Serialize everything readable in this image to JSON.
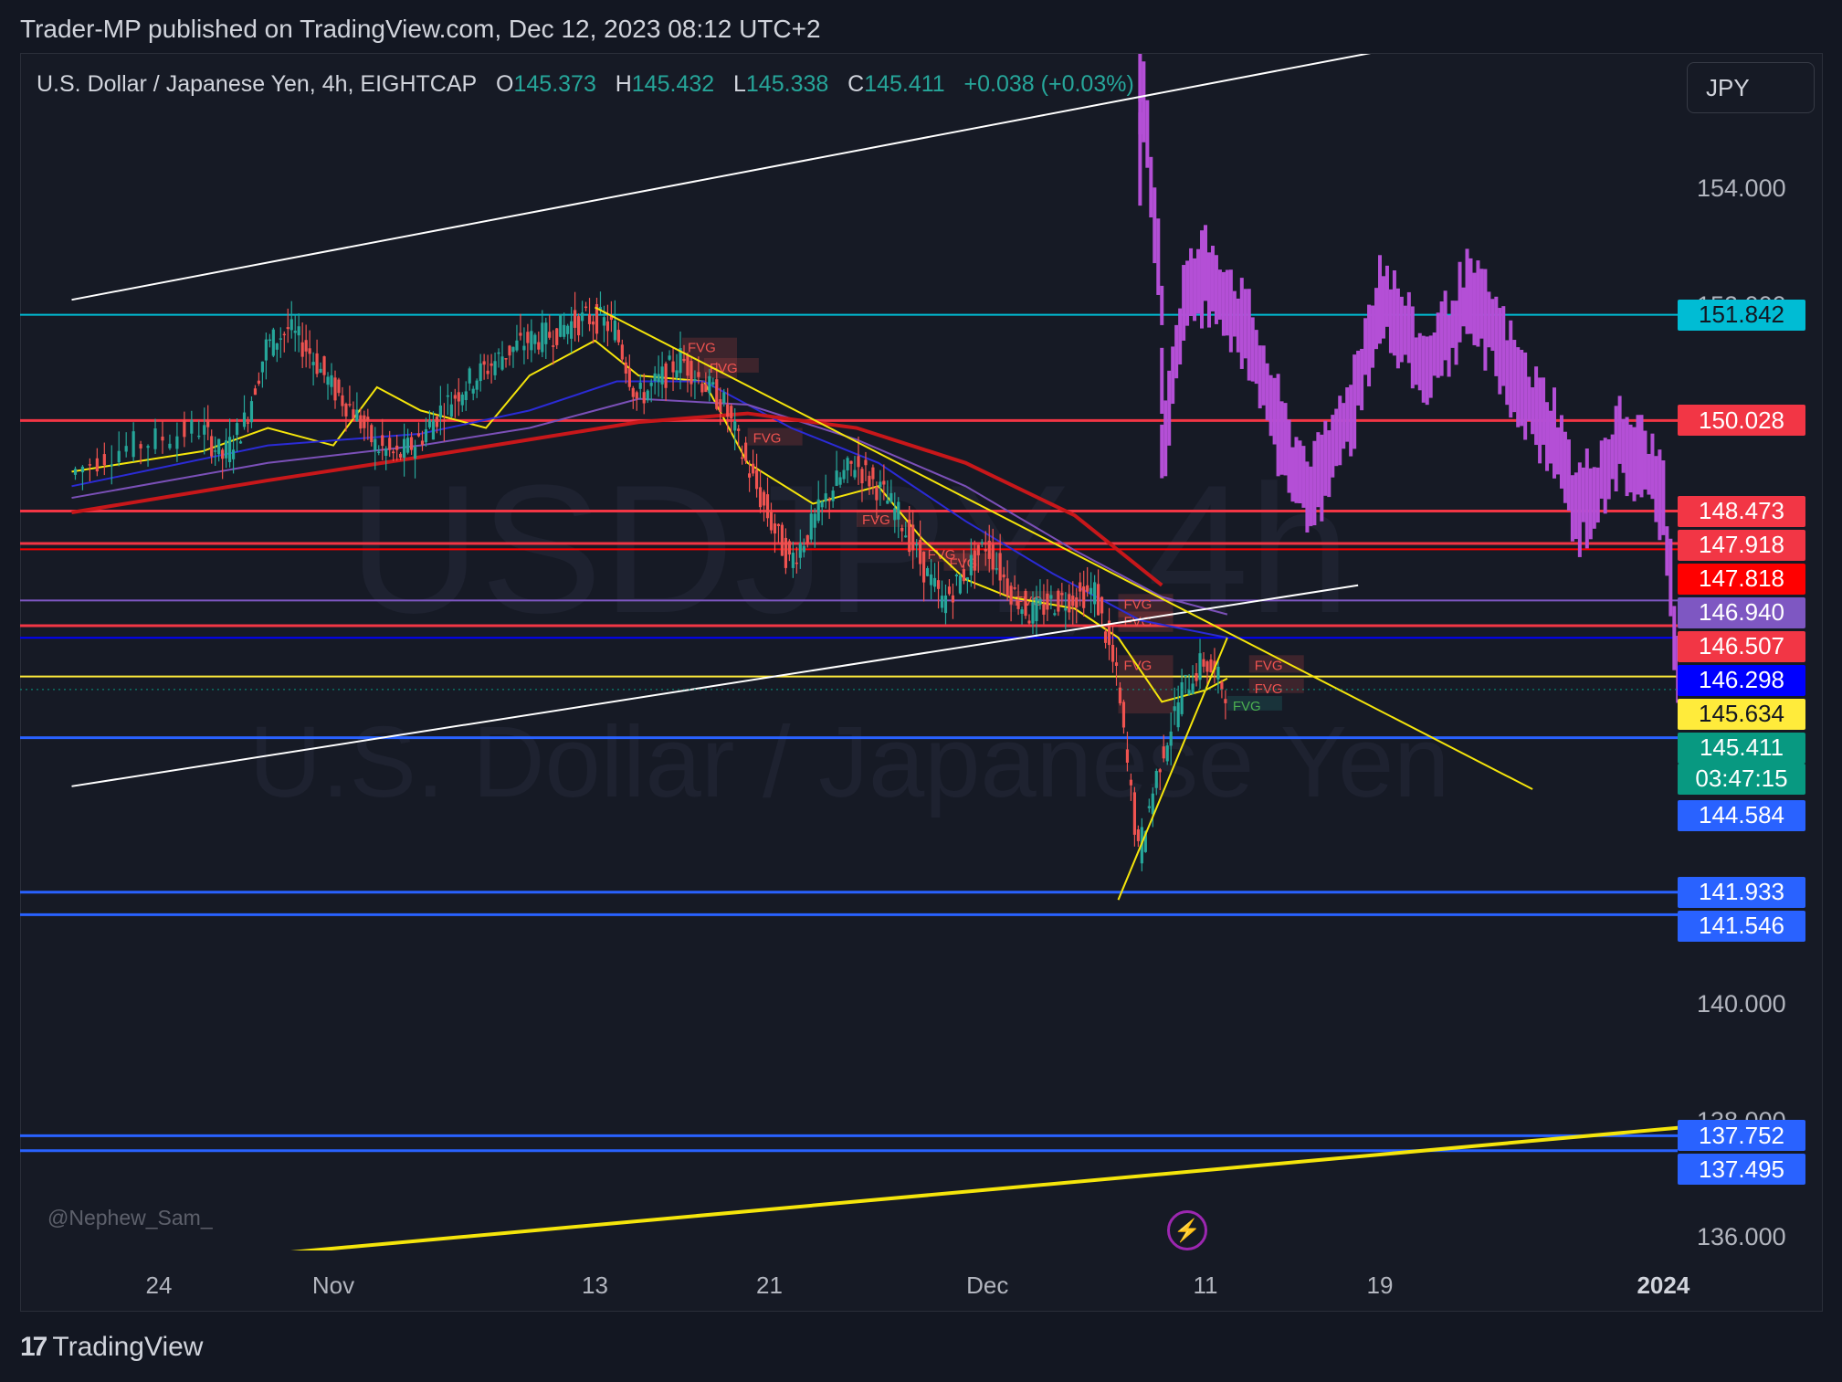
{
  "caption": "Trader-MP published on TradingView.com, Dec 12, 2023 08:12 UTC+2",
  "footer_brand": "TradingView",
  "footer_mark": "17",
  "currency_button": "JPY",
  "user_watermark": "@Nephew_Sam_",
  "bolt_icon": "lightning-bolt-icon",
  "watermark": {
    "symbol": "USDJPY, 4h",
    "name": "U.S. Dollar / Japanese Yen"
  },
  "legend": {
    "symbol": "U.S. Dollar / Japanese Yen, 4h, EIGHTCAP",
    "o_label": "O",
    "o": "145.373",
    "h_label": "H",
    "h": "145.432",
    "l_label": "L",
    "l": "145.338",
    "c_label": "C",
    "c": "145.411",
    "change": "+0.038 (+0.03%)"
  },
  "colors": {
    "bull": "#26a69a",
    "bear": "#ef5350",
    "projection": "#b44fd6",
    "ema_fast": "#f5e50b",
    "ema_mid": "#2b2bd6",
    "ema_slow": "#7b50b8",
    "ema_200": "#c8171a",
    "cyan": "#00bcd4",
    "red_line": "#f23645",
    "blue_line": "#2962ff"
  },
  "chart_data": {
    "type": "candlestick",
    "symbol": "USDJPY",
    "timeframe": "4h",
    "exchange": "EIGHTCAP",
    "last_price": 145.411,
    "countdown": "03:47:15",
    "price_axis_ticks": [
      "154.000",
      "152.000",
      "144.000",
      "140.000",
      "138.000",
      "136.000"
    ],
    "time_axis_ticks": [
      {
        "label": "24",
        "date": "2023-10-24"
      },
      {
        "label": "Nov",
        "date": "2023-11-01"
      },
      {
        "label": "13",
        "date": "2023-11-13"
      },
      {
        "label": "21",
        "date": "2023-11-21"
      },
      {
        "label": "Dec",
        "date": "2023-12-01"
      },
      {
        "label": "11",
        "date": "2023-12-11"
      },
      {
        "label": "19",
        "date": "2023-12-19"
      },
      {
        "label": "2024",
        "date": "2024-01-01"
      }
    ],
    "horizontal_levels": [
      {
        "price": 151.842,
        "label": "151.842",
        "color": "#00bcd4",
        "text_color": "#131722"
      },
      {
        "price": 150.028,
        "label": "150.028",
        "color": "#f23645",
        "text_color": "#ffffff"
      },
      {
        "price": 148.473,
        "label": "148.473",
        "color": "#f23645",
        "text_color": "#ffffff"
      },
      {
        "price": 147.918,
        "label": "147.918",
        "color": "#f23645",
        "text_color": "#ffffff"
      },
      {
        "price": 147.818,
        "label": "147.818",
        "color": "#ff0000",
        "text_color": "#ffffff"
      },
      {
        "price": 146.94,
        "label": "146.940",
        "color": "#7e57c2",
        "text_color": "#ffffff"
      },
      {
        "price": 146.507,
        "label": "146.507",
        "color": "#f23645",
        "text_color": "#ffffff"
      },
      {
        "price": 146.298,
        "label": "146.298",
        "color": "#0000ff",
        "text_color": "#ffffff"
      },
      {
        "price": 145.634,
        "label": "145.634",
        "color": "#ffeb3b",
        "text_color": "#131722"
      },
      {
        "price": 145.411,
        "label": "145.411",
        "color": "#089981",
        "text_color": "#ffffff"
      },
      {
        "price": 144.584,
        "label": "144.584",
        "color": "#2962ff",
        "text_color": "#ffffff"
      },
      {
        "price": 141.933,
        "label": "141.933",
        "color": "#2962ff",
        "text_color": "#ffffff"
      },
      {
        "price": 141.546,
        "label": "141.546",
        "color": "#2962ff",
        "text_color": "#ffffff"
      },
      {
        "price": 137.752,
        "label": "137.752",
        "color": "#2962ff",
        "text_color": "#ffffff"
      },
      {
        "price": 137.495,
        "label": "137.495",
        "color": "#2962ff",
        "text_color": "#ffffff"
      }
    ],
    "fvg_label": "FVG",
    "fvg_zones": [
      {
        "date": "2023-11-17",
        "price_top": 151.45,
        "price_bottom": 150.75,
        "type": "bear"
      },
      {
        "date": "2023-11-18",
        "price_top": 151.1,
        "price_bottom": 150.85,
        "type": "bear"
      },
      {
        "date": "2023-11-20",
        "price_top": 149.9,
        "price_bottom": 149.6,
        "type": "bear"
      },
      {
        "date": "2023-11-25",
        "price_top": 148.5,
        "price_bottom": 148.2,
        "type": "bear"
      },
      {
        "date": "2023-11-28",
        "price_top": 147.9,
        "price_bottom": 147.6,
        "type": "bear"
      },
      {
        "date": "2023-11-29",
        "price_top": 147.75,
        "price_bottom": 147.45,
        "type": "bear"
      },
      {
        "date": "2023-12-02",
        "price_top": 147.1,
        "price_bottom": 146.85,
        "type": "bear"
      },
      {
        "date": "2023-12-07",
        "price_top": 147.05,
        "price_bottom": 146.65,
        "type": "bear"
      },
      {
        "date": "2023-12-07",
        "price_top": 146.75,
        "price_bottom": 146.4,
        "type": "bear"
      },
      {
        "date": "2023-12-07",
        "price_top": 146.0,
        "price_bottom": 145.0,
        "type": "bear"
      },
      {
        "date": "2023-12-13",
        "price_top": 146.0,
        "price_bottom": 145.7,
        "type": "bear"
      },
      {
        "date": "2023-12-13",
        "price_top": 145.6,
        "price_bottom": 145.35,
        "type": "bear"
      },
      {
        "date": "2023-12-12",
        "price_top": 145.3,
        "price_bottom": 145.05,
        "type": "bull"
      }
    ],
    "trendlines": [
      {
        "color": "#ffffff",
        "width": 2,
        "p1": {
          "date": "2023-10-20",
          "price": 152.1
        },
        "p2": {
          "date": "2023-12-23",
          "price": 156.65
        }
      },
      {
        "color": "#ffffff",
        "width": 2,
        "p1": {
          "date": "2023-10-20",
          "price": 143.75
        },
        "p2": {
          "date": "2023-12-18",
          "price": 147.2
        }
      },
      {
        "color": "#f5e50b",
        "width": 2,
        "p1": {
          "date": "2023-11-13",
          "price": 151.97
        },
        "p2": {
          "date": "2023-12-26",
          "price": 143.7
        }
      },
      {
        "color": "#f5e50b",
        "width": 4,
        "p1": {
          "date": "2023-10-30",
          "price": 135.75
        },
        "p2": {
          "date": "2024-01-05",
          "price": 138.0
        }
      },
      {
        "color": "#f5e50b",
        "width": 2,
        "p1": {
          "date": "2023-12-07",
          "price": 141.8
        },
        "p2": {
          "date": "2023-12-12",
          "price": 146.3
        }
      }
    ],
    "projection_path": [
      {
        "date": "2023-12-08",
        "price": 154.5
      },
      {
        "date": "2023-12-08",
        "price": 156.0
      },
      {
        "date": "2023-12-09",
        "price": 152.0
      },
      {
        "date": "2023-12-09",
        "price": 149.5
      },
      {
        "date": "2023-12-10",
        "price": 152.0
      },
      {
        "date": "2023-12-11",
        "price": 152.6
      },
      {
        "date": "2023-12-12",
        "price": 152.1
      },
      {
        "date": "2023-12-13",
        "price": 151.4
      },
      {
        "date": "2023-12-14",
        "price": 150.3
      },
      {
        "date": "2023-12-15",
        "price": 149.2
      },
      {
        "date": "2023-12-16",
        "price": 148.8
      },
      {
        "date": "2023-12-17",
        "price": 149.6
      },
      {
        "date": "2023-12-18",
        "price": 150.6
      },
      {
        "date": "2023-12-19",
        "price": 152.2
      },
      {
        "date": "2023-12-20",
        "price": 151.6
      },
      {
        "date": "2023-12-21",
        "price": 150.8
      },
      {
        "date": "2023-12-22",
        "price": 151.4
      },
      {
        "date": "2023-12-23",
        "price": 152.1
      },
      {
        "date": "2023-12-24",
        "price": 151.7
      },
      {
        "date": "2023-12-25",
        "price": 150.9
      },
      {
        "date": "2023-12-26",
        "price": 150.2
      },
      {
        "date": "2023-12-27",
        "price": 149.8
      },
      {
        "date": "2023-12-28",
        "price": 148.5
      },
      {
        "date": "2023-12-29",
        "price": 148.9
      },
      {
        "date": "2023-12-30",
        "price": 149.6
      },
      {
        "date": "2023-12-31",
        "price": 149.3
      },
      {
        "date": "2024-01-01",
        "price": 148.7
      },
      {
        "date": "2024-01-02",
        "price": 143.9
      },
      {
        "date": "2024-01-03",
        "price": 143.3
      },
      {
        "date": "2024-01-04",
        "price": 142.2
      },
      {
        "date": "2024-01-05",
        "price": 143.0
      },
      {
        "date": "2024-01-06",
        "price": 143.5
      },
      {
        "date": "2024-01-07",
        "price": 142.5
      },
      {
        "date": "2024-01-08",
        "price": 141.7
      },
      {
        "date": "2024-01-08",
        "price": 142.8
      }
    ],
    "moving_averages": {
      "ema_fast": [
        {
          "date": "2023-10-20",
          "price": 149.15
        },
        {
          "date": "2023-10-26",
          "price": 149.5
        },
        {
          "date": "2023-10-29",
          "price": 149.9
        },
        {
          "date": "2023-11-01",
          "price": 149.6
        },
        {
          "date": "2023-11-03",
          "price": 150.6
        },
        {
          "date": "2023-11-05",
          "price": 150.2
        },
        {
          "date": "2023-11-08",
          "price": 149.9
        },
        {
          "date": "2023-11-10",
          "price": 150.8
        },
        {
          "date": "2023-11-13",
          "price": 151.4
        },
        {
          "date": "2023-11-15",
          "price": 150.8
        },
        {
          "date": "2023-11-18",
          "price": 150.7
        },
        {
          "date": "2023-11-20",
          "price": 149.3
        },
        {
          "date": "2023-11-23",
          "price": 148.6
        },
        {
          "date": "2023-11-26",
          "price": 148.9
        },
        {
          "date": "2023-11-28",
          "price": 148.0
        },
        {
          "date": "2023-11-30",
          "price": 147.3
        },
        {
          "date": "2023-12-02",
          "price": 147.0
        },
        {
          "date": "2023-12-05",
          "price": 146.8
        },
        {
          "date": "2023-12-07",
          "price": 146.3
        },
        {
          "date": "2023-12-09",
          "price": 145.2
        },
        {
          "date": "2023-12-11",
          "price": 145.4
        },
        {
          "date": "2023-12-12",
          "price": 145.6
        }
      ],
      "ema_mid": [
        {
          "date": "2023-10-20",
          "price": 148.9
        },
        {
          "date": "2023-10-29",
          "price": 149.6
        },
        {
          "date": "2023-11-05",
          "price": 149.8
        },
        {
          "date": "2023-11-10",
          "price": 150.2
        },
        {
          "date": "2023-11-14",
          "price": 150.7
        },
        {
          "date": "2023-11-18",
          "price": 150.7
        },
        {
          "date": "2023-11-22",
          "price": 149.9
        },
        {
          "date": "2023-11-26",
          "price": 149.3
        },
        {
          "date": "2023-11-30",
          "price": 148.3
        },
        {
          "date": "2023-12-04",
          "price": 147.4
        },
        {
          "date": "2023-12-08",
          "price": 146.6
        },
        {
          "date": "2023-12-12",
          "price": 146.3
        }
      ],
      "ema_slow": [
        {
          "date": "2023-10-20",
          "price": 148.7
        },
        {
          "date": "2023-10-29",
          "price": 149.3
        },
        {
          "date": "2023-11-05",
          "price": 149.6
        },
        {
          "date": "2023-11-10",
          "price": 149.9
        },
        {
          "date": "2023-11-15",
          "price": 150.4
        },
        {
          "date": "2023-11-20",
          "price": 150.3
        },
        {
          "date": "2023-11-25",
          "price": 149.7
        },
        {
          "date": "2023-11-30",
          "price": 148.9
        },
        {
          "date": "2023-12-05",
          "price": 147.8
        },
        {
          "date": "2023-12-09",
          "price": 147.0
        },
        {
          "date": "2023-12-12",
          "price": 146.7
        }
      ],
      "ema_200": [
        {
          "date": "2023-10-20",
          "price": 148.45
        },
        {
          "date": "2023-10-29",
          "price": 149.0
        },
        {
          "date": "2023-11-05",
          "price": 149.4
        },
        {
          "date": "2023-11-10",
          "price": 149.7
        },
        {
          "date": "2023-11-15",
          "price": 150.0
        },
        {
          "date": "2023-11-20",
          "price": 150.15
        },
        {
          "date": "2023-11-25",
          "price": 149.9
        },
        {
          "date": "2023-11-30",
          "price": 149.3
        },
        {
          "date": "2023-12-05",
          "price": 148.4
        },
        {
          "date": "2023-12-09",
          "price": 147.2
        }
      ]
    },
    "candles_close": [
      {
        "date": "2023-10-20",
        "price": 149.1
      },
      {
        "date": "2023-10-22",
        "price": 149.5
      },
      {
        "date": "2023-10-24",
        "price": 149.7
      },
      {
        "date": "2023-10-26",
        "price": 149.9
      },
      {
        "date": "2023-10-27",
        "price": 149.4
      },
      {
        "date": "2023-10-28",
        "price": 150.0
      },
      {
        "date": "2023-10-29",
        "price": 151.3
      },
      {
        "date": "2023-10-30",
        "price": 151.6
      },
      {
        "date": "2023-10-31",
        "price": 151.2
      },
      {
        "date": "2023-11-01",
        "price": 150.6
      },
      {
        "date": "2023-11-02",
        "price": 150.2
      },
      {
        "date": "2023-11-03",
        "price": 149.6
      },
      {
        "date": "2023-11-04",
        "price": 149.4
      },
      {
        "date": "2023-11-05",
        "price": 149.7
      },
      {
        "date": "2023-11-06",
        "price": 150.2
      },
      {
        "date": "2023-11-07",
        "price": 150.6
      },
      {
        "date": "2023-11-08",
        "price": 150.9
      },
      {
        "date": "2023-11-09",
        "price": 151.2
      },
      {
        "date": "2023-11-10",
        "price": 151.4
      },
      {
        "date": "2023-11-11",
        "price": 151.5
      },
      {
        "date": "2023-11-12",
        "price": 151.7
      },
      {
        "date": "2023-11-13",
        "price": 151.8
      },
      {
        "date": "2023-11-14",
        "price": 151.6
      },
      {
        "date": "2023-11-15",
        "price": 150.4
      },
      {
        "date": "2023-11-16",
        "price": 150.7
      },
      {
        "date": "2023-11-17",
        "price": 151.1
      },
      {
        "date": "2023-11-18",
        "price": 150.7
      },
      {
        "date": "2023-11-19",
        "price": 150.3
      },
      {
        "date": "2023-11-20",
        "price": 149.3
      },
      {
        "date": "2023-11-21",
        "price": 148.4
      },
      {
        "date": "2023-11-22",
        "price": 147.6
      },
      {
        "date": "2023-11-23",
        "price": 148.2
      },
      {
        "date": "2023-11-24",
        "price": 148.9
      },
      {
        "date": "2023-11-25",
        "price": 149.3
      },
      {
        "date": "2023-11-26",
        "price": 148.9
      },
      {
        "date": "2023-11-27",
        "price": 148.4
      },
      {
        "date": "2023-11-28",
        "price": 147.6
      },
      {
        "date": "2023-11-29",
        "price": 146.9
      },
      {
        "date": "2023-11-30",
        "price": 147.4
      },
      {
        "date": "2023-12-01",
        "price": 147.9
      },
      {
        "date": "2023-12-02",
        "price": 147.2
      },
      {
        "date": "2023-12-03",
        "price": 146.7
      },
      {
        "date": "2023-12-04",
        "price": 146.9
      },
      {
        "date": "2023-12-05",
        "price": 147.0
      },
      {
        "date": "2023-12-06",
        "price": 147.1
      },
      {
        "date": "2023-12-07",
        "price": 145.6
      },
      {
        "date": "2023-12-08",
        "price": 142.6
      },
      {
        "date": "2023-12-09",
        "price": 144.2
      },
      {
        "date": "2023-12-10",
        "price": 145.4
      },
      {
        "date": "2023-12-11",
        "price": 145.9
      },
      {
        "date": "2023-12-12",
        "price": 145.41
      }
    ]
  }
}
